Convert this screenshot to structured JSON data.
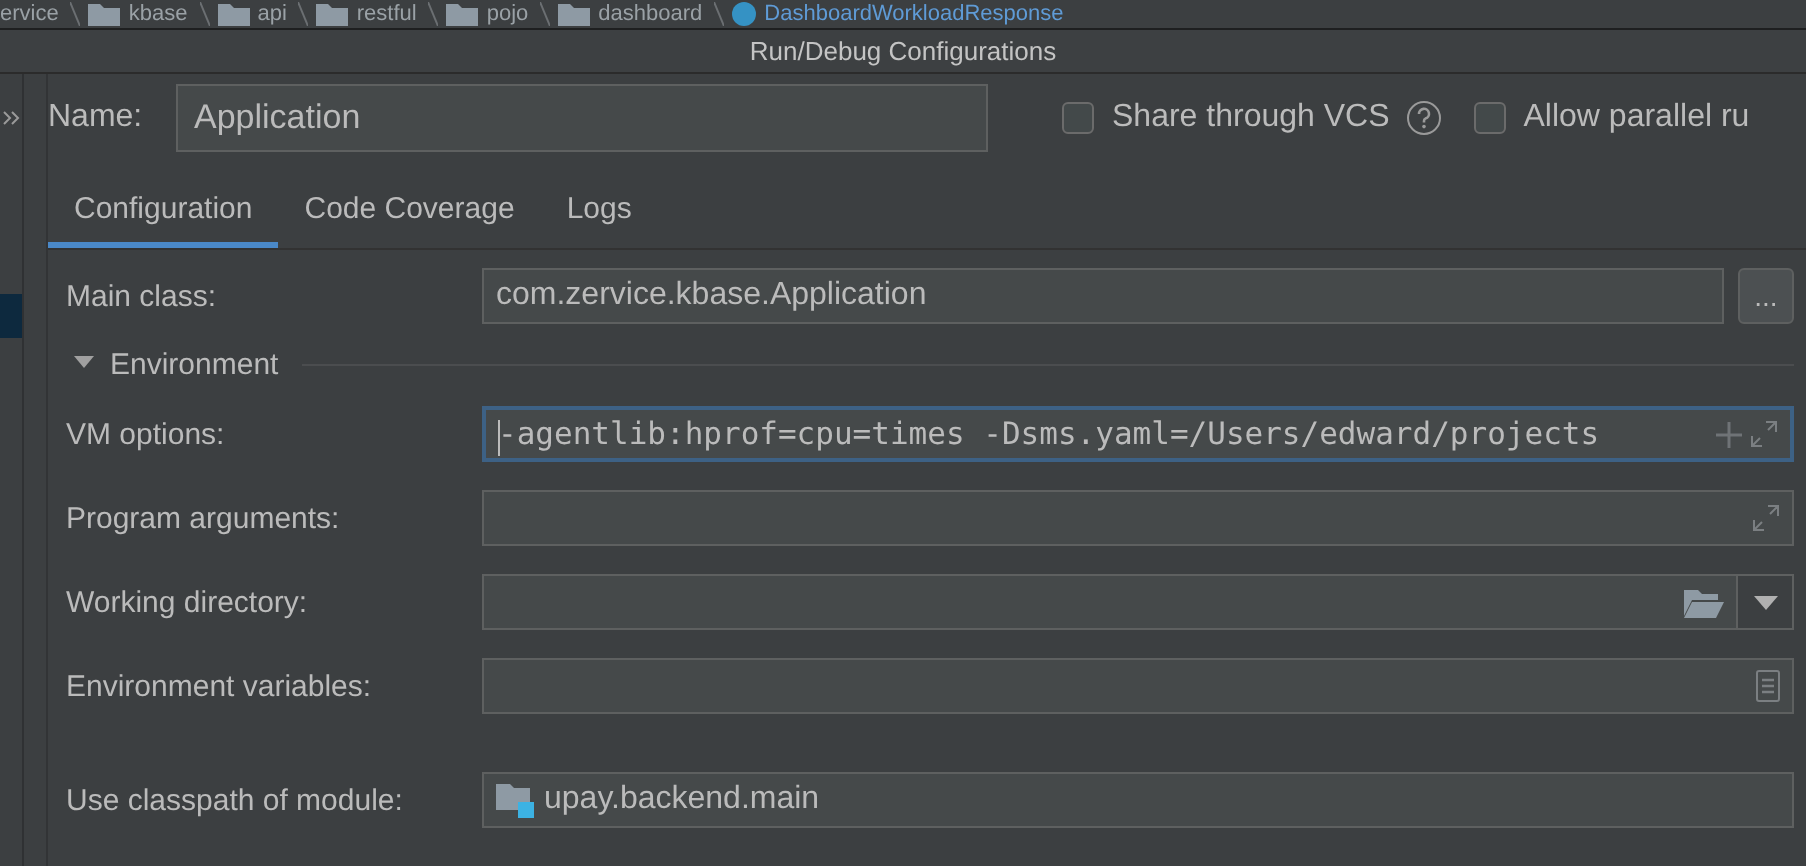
{
  "breadcrumb": [
    {
      "label": "ervice",
      "kind": "plain"
    },
    {
      "label": "kbase",
      "kind": "folder"
    },
    {
      "label": "api",
      "kind": "folder"
    },
    {
      "label": "restful",
      "kind": "folder"
    },
    {
      "label": "pojo",
      "kind": "folder"
    },
    {
      "label": "dashboard",
      "kind": "folder"
    },
    {
      "label": "DashboardWorkloadResponse",
      "kind": "class"
    }
  ],
  "window": {
    "title": "Run/Debug Configurations"
  },
  "name_field": {
    "label": "Name:",
    "value": "Application"
  },
  "options": [
    {
      "label": "Share through VCS",
      "checked": false,
      "help": true
    },
    {
      "label": "Allow parallel ru",
      "checked": false,
      "help": false
    }
  ],
  "tabs": [
    {
      "label": "Configuration",
      "selected": true
    },
    {
      "label": "Code Coverage",
      "selected": false
    },
    {
      "label": "Logs",
      "selected": false
    }
  ],
  "rows": [
    {
      "kind": "class",
      "label": "Main class:",
      "value": "com.zervice.kbase.Application",
      "button": "..."
    },
    {
      "kind": "section",
      "label": "Environment",
      "expanded": true
    },
    {
      "kind": "options",
      "label": "VM options:",
      "value": "-agentlib:hprof=cpu=times -Dsms.yaml=/Users/edward/projects",
      "focused": true
    },
    {
      "kind": "arguments",
      "label": "Program arguments:",
      "focused": false
    },
    {
      "kind": "directory",
      "label": "Working directory:",
      "focused": false
    },
    {
      "kind": "variables",
      "label": "Environment variables:",
      "focused": false
    },
    {
      "kind": "module",
      "label": "Use classpath of module:",
      "value": "upay.backend.main"
    }
  ]
}
